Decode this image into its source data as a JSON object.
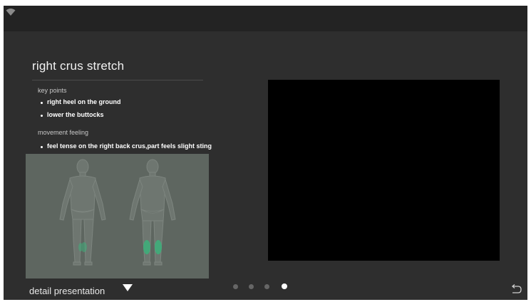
{
  "exercise": {
    "title": "right crus stretch",
    "key_points_label": "key points",
    "key_points": [
      "right heel on the ground",
      "lower the buttocks"
    ],
    "movement_feeling_label": "movement feeling",
    "movement_feelings": [
      "feel tense on the right back crus,part feels slight sting"
    ]
  },
  "footer": {
    "detail_label": "detail presentation"
  },
  "pager": {
    "total": 4,
    "current": 4
  },
  "icons": {
    "status": "wifi-icon",
    "dropdown": "triangle-down-icon",
    "back": "back-arrow-icon"
  },
  "colors": {
    "background": "#2e2e2e",
    "status_bar": "#232323",
    "highlight_muscle": "#3fae7a",
    "video_area": "#000000"
  }
}
